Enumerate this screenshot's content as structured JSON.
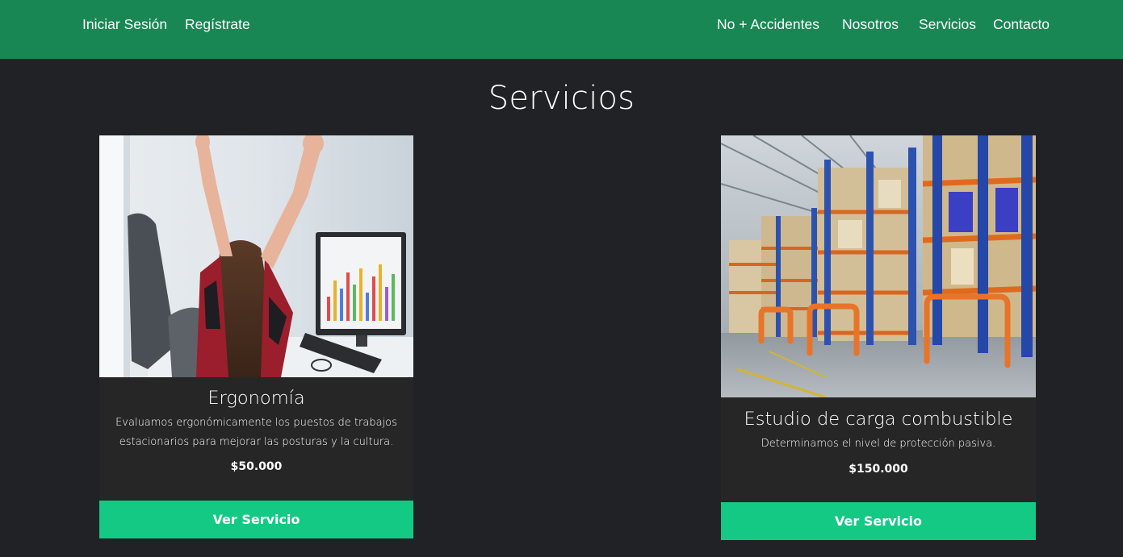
{
  "nav": {
    "login": "Iniciar Sesión",
    "register": "Regístrate",
    "no_accidents": "No + Accidentes",
    "about": "Nosotros",
    "services": "Servicios",
    "contact": "Contacto"
  },
  "page": {
    "title": "Servicios"
  },
  "services": [
    {
      "title": "Ergonomía",
      "description": "Evaluamos ergonómicamente los puestos de trabajos estacionarios para mejorar las posturas y la cultura.",
      "price": "$50.000",
      "button": "Ver Servicio"
    },
    {
      "title": "Estudio de carga combustible",
      "description": "Determinamos el nivel de protección pasiva.",
      "price": "$150.000",
      "button": "Ver Servicio"
    }
  ],
  "colors": {
    "navbar": "#198754",
    "background": "#202226",
    "card": "#262626",
    "button": "#14c984"
  }
}
